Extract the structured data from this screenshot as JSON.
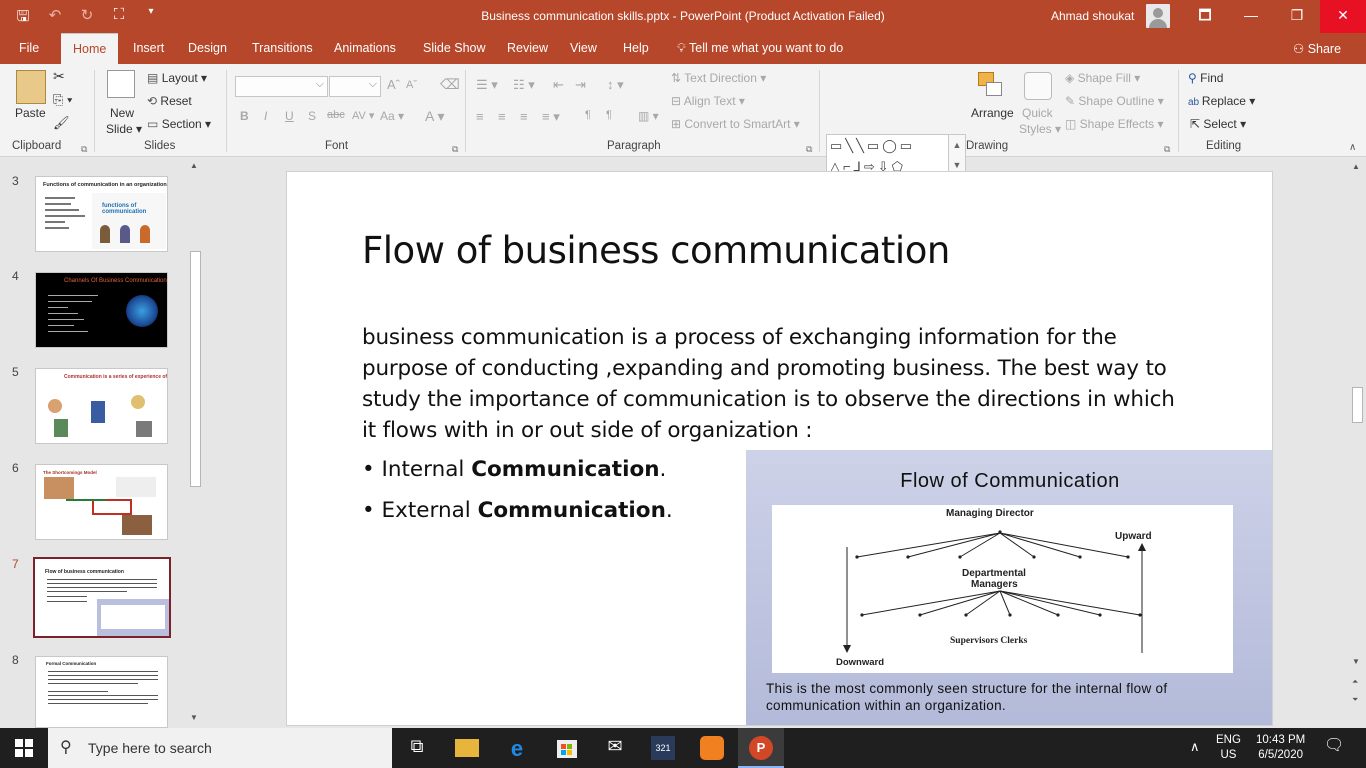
{
  "window": {
    "title": "Business communication skills.pptx  -  PowerPoint (Product Activation Failed)",
    "user": "Ahmad shoukat",
    "minimize": "🗖",
    "restore": "❐",
    "maximize": "—",
    "close": "✕"
  },
  "tabs": [
    "File",
    "Home",
    "Insert",
    "Design",
    "Transitions",
    "Animations",
    "Slide Show",
    "Review",
    "View",
    "Help"
  ],
  "tell_me": "Tell me what you want to do",
  "share": "Share",
  "ribbon": {
    "clipboard": {
      "paste": "Paste",
      "label": "Clipboard"
    },
    "slides": {
      "new_slide_1": "New",
      "new_slide_2": "Slide",
      "layout": "Layout",
      "reset": "Reset",
      "section": "Section",
      "label": "Slides"
    },
    "font": {
      "label": "Font",
      "bold": "B",
      "italic": "I",
      "underline": "U",
      "shadow": "S",
      "strike": "abc",
      "spacing": "AV",
      "case": "Aa",
      "color": "A",
      "grow": "A",
      "shrink": "A"
    },
    "paragraph": {
      "label": "Paragraph",
      "text_direction": "Text Direction",
      "align_text": "Align Text",
      "convert_smartart": "Convert to SmartArt"
    },
    "drawing": {
      "label": "Drawing",
      "arrange": "Arrange",
      "quick_styles_1": "Quick",
      "quick_styles_2": "Styles",
      "shape_fill": "Shape Fill",
      "shape_outline": "Shape Outline",
      "shape_effects": "Shape Effects"
    },
    "editing": {
      "label": "Editing",
      "find": "Find",
      "replace": "Replace",
      "select": "Select"
    }
  },
  "thumbnails": [
    {
      "num": "3",
      "title": "Functions of communication in an organization",
      "active": false
    },
    {
      "num": "4",
      "title": "Channels Of Business Communication",
      "active": false
    },
    {
      "num": "5",
      "title": "Communication is a series of experience of",
      "active": false
    },
    {
      "num": "6",
      "title": "The Shortcomings Model",
      "active": false
    },
    {
      "num": "7",
      "title": "Flow of business communication",
      "active": true
    },
    {
      "num": "8",
      "title": "Formal Communication",
      "active": false
    }
  ],
  "slide": {
    "title": "Flow of business communication",
    "body": "  business communication is a process of exchanging information for the purpose of conducting ,expanding and promoting business. The best way to study the importance of communication is to observe the directions in which it flows with in or out side of organization :",
    "bullet1_pre": "• Internal ",
    "bullet1_bold": "Communication",
    "bullet1_post": ".",
    "bullet2_pre": "•  External ",
    "bullet2_bold": "Communication",
    "bullet2_post": ".",
    "picture": {
      "title": "Flow of Communication",
      "managing_director": "Managing Director",
      "upward": "Upward",
      "departmental": "Departmental",
      "managers": "Managers",
      "supervisors": "Supervisors Clerks",
      "downward": "Downward",
      "caption": "This is the most commonly seen structure for the internal flow of communication within an organization."
    }
  },
  "taskbar": {
    "search_placeholder": "Type here to search",
    "lang1": "ENG",
    "lang2": "US",
    "time": "10:43 PM",
    "date": "6/5/2020"
  },
  "colors": {
    "accent": "#b7472a",
    "selected_thumb": "#7b2129"
  }
}
